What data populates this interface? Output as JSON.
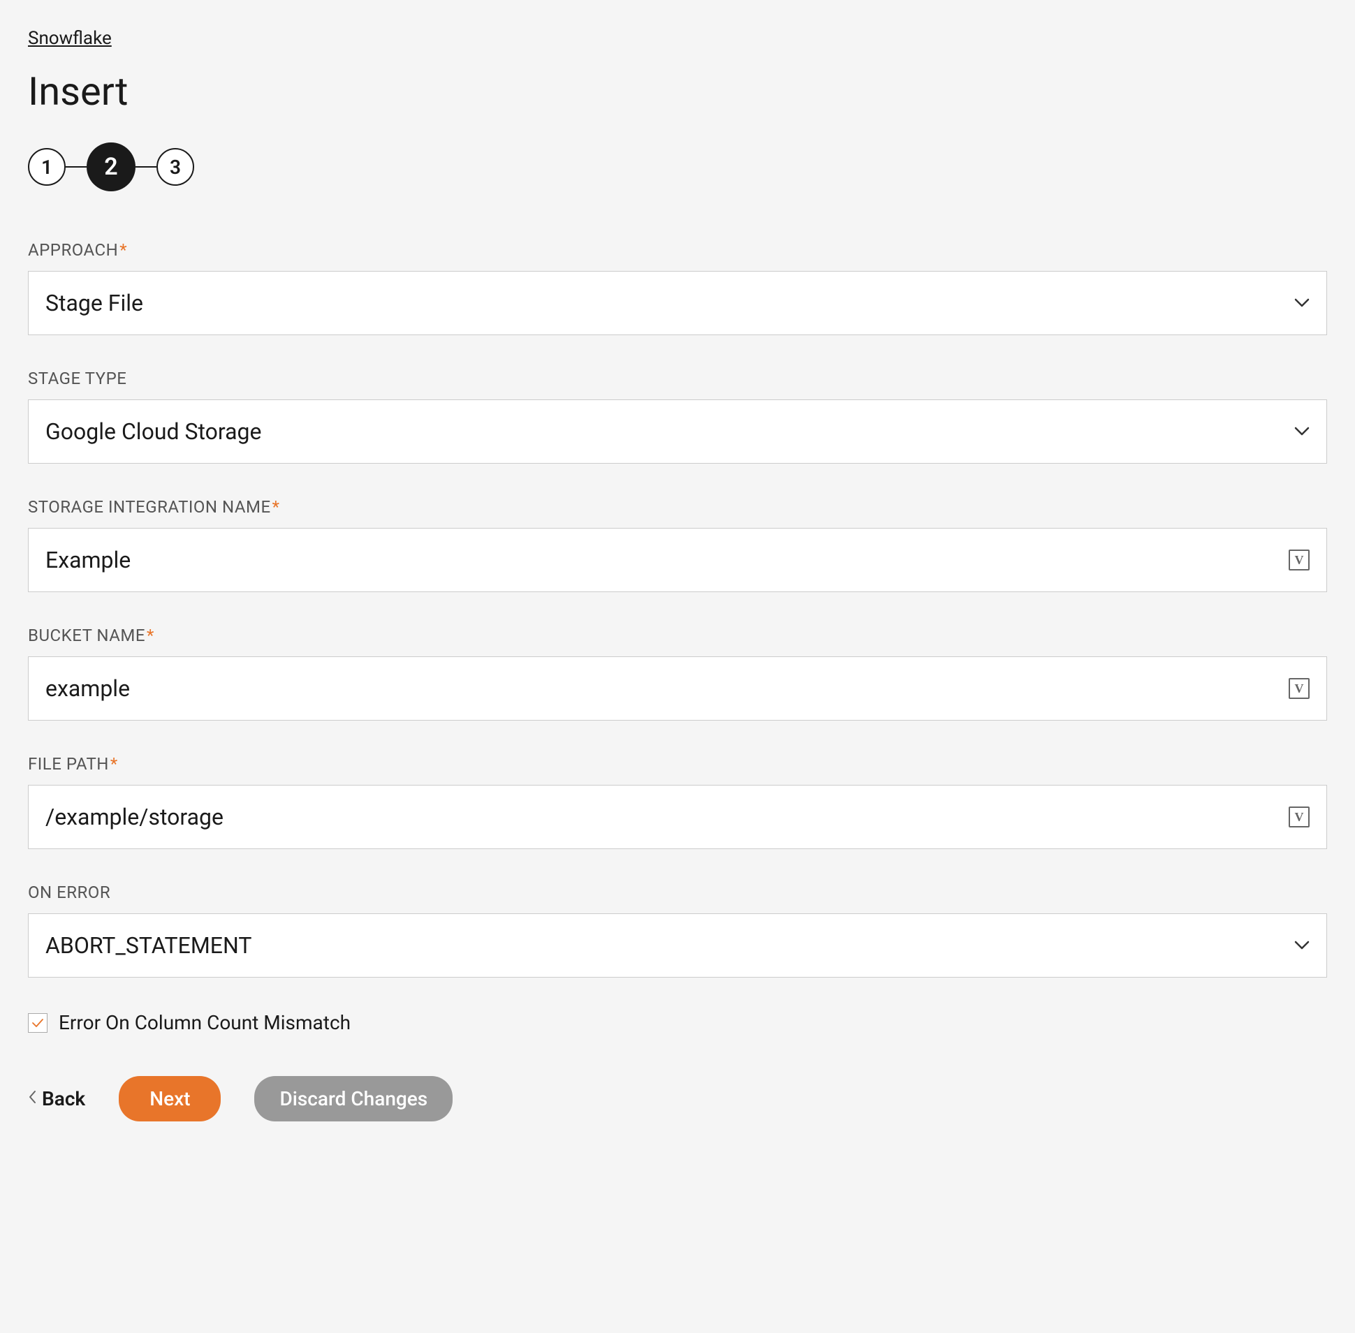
{
  "breadcrumb": "Snowflake",
  "page_title": "Insert",
  "stepper": {
    "step1": "1",
    "step2": "2",
    "step3": "3"
  },
  "fields": {
    "approach": {
      "label": "APPROACH",
      "value": "Stage File"
    },
    "stage_type": {
      "label": "STAGE TYPE",
      "value": "Google Cloud Storage"
    },
    "storage_integration": {
      "label": "STORAGE INTEGRATION NAME",
      "value": "Example"
    },
    "bucket_name": {
      "label": "BUCKET NAME",
      "value": "example"
    },
    "file_path": {
      "label": "FILE PATH",
      "value": "/example/storage"
    },
    "on_error": {
      "label": "ON ERROR",
      "value": "ABORT_STATEMENT"
    }
  },
  "checkbox": {
    "label": "Error On Column Count Mismatch"
  },
  "buttons": {
    "back": "Back",
    "next": "Next",
    "discard": "Discard Changes"
  },
  "glyphs": {
    "var": "V",
    "required": "*"
  }
}
